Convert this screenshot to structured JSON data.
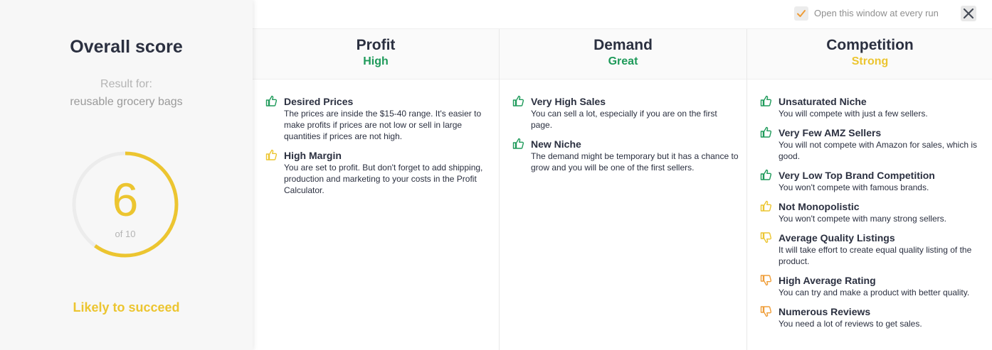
{
  "colors": {
    "green": "#1e9a5a",
    "yellow": "#ecc530",
    "orange": "#ef9d38"
  },
  "left": {
    "title": "Overall score",
    "result_for": "Result for:",
    "query": "reusable grocery bags",
    "score": "6",
    "score_of": "of 10",
    "score_fraction": 0.6,
    "verdict": "Likely to succeed"
  },
  "topbar": {
    "checkbox_label": "Open this window at every run",
    "checkbox_checked": true
  },
  "columns": [
    {
      "title": "Profit",
      "level": "High",
      "level_color": "#1e9a5a",
      "items": [
        {
          "icon": "thumbs-up-green-icon",
          "title": "Desired Prices",
          "desc": "The prices are inside the $15-40 range. It's easier to make profits if prices are not low or sell in large quantities if prices are not high."
        },
        {
          "icon": "thumbs-up-yellow-icon",
          "title": "High Margin",
          "desc": "You are set to profit. But don't forget to add shipping, production and marketing to your costs in the Profit Calculator."
        }
      ]
    },
    {
      "title": "Demand",
      "level": "Great",
      "level_color": "#1e9a5a",
      "items": [
        {
          "icon": "thumbs-up-green-icon",
          "title": "Very High Sales",
          "desc": "You can sell a lot, especially if you are on the first page."
        },
        {
          "icon": "thumbs-up-green-icon",
          "title": "New Niche",
          "desc": "The demand might be temporary but it has a chance to grow and you will be one of the first sellers."
        }
      ]
    },
    {
      "title": "Competition",
      "level": "Strong",
      "level_color": "#ecc530",
      "items": [
        {
          "icon": "thumbs-up-green-icon",
          "title": "Unsaturated Niche",
          "desc": "You will compete with just a few sellers."
        },
        {
          "icon": "thumbs-up-green-icon",
          "title": "Very Few AMZ Sellers",
          "desc": "You will not compete with Amazon for sales, which is good."
        },
        {
          "icon": "thumbs-up-green-icon",
          "title": "Very Low Top Brand Competition",
          "desc": "You won't compete with famous brands."
        },
        {
          "icon": "thumbs-up-yellow-icon",
          "title": "Not Monopolistic",
          "desc": "You won't compete with many strong sellers."
        },
        {
          "icon": "thumbs-down-yellow-icon",
          "title": "Average Quality Listings",
          "desc": "It will take effort to create equal quality listing of the product."
        },
        {
          "icon": "thumbs-down-orange-icon",
          "title": "High Average Rating",
          "desc": "You can try and make a product with better quality."
        },
        {
          "icon": "thumbs-down-orange-icon",
          "title": "Numerous Reviews",
          "desc": "You need a lot of reviews to get sales."
        }
      ]
    }
  ]
}
